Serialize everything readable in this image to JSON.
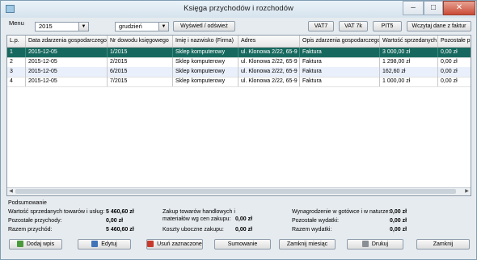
{
  "window": {
    "title": "Księga przychodów i rozchodów",
    "minimize": "–",
    "maximize": "□",
    "close": "✕"
  },
  "toolbar": {
    "menu_label": "Menu",
    "year": "2015",
    "month": "grudzień",
    "show_refresh": "Wyświetl / odśwież",
    "vat7": "VAT7",
    "vat7k": "VAT 7k",
    "pit5": "PIT5",
    "load_invoices": "Wczytaj dane z faktur"
  },
  "table": {
    "columns": [
      "L.p.",
      "Data zdarzenia gospodarczego",
      "Nr dowodu księgowego",
      "Imię i nazwisko (Firma)",
      "Adres",
      "Opis zdarzenia gospodarczego",
      "Wartość sprzedanych",
      "Pozostałe p"
    ],
    "rows": [
      [
        "1",
        "2015-12-05",
        "1/2015",
        "Sklep komputerowy",
        "ul. Klonowa 2/22, 65-9",
        "Faktura",
        "3 000,00 zł",
        "0,00 zł"
      ],
      [
        "2",
        "2015-12-05",
        "2/2015",
        "Sklep komputerowy",
        "ul. Klonowa 2/22, 65-9",
        "Faktura",
        "1 298,00 zł",
        "0,00 zł"
      ],
      [
        "3",
        "2015-12-05",
        "6/2015",
        "Sklep komputerowy",
        "ul. Klonowa 2/22, 65-9",
        "Faktura",
        "162,60 zł",
        "0,00 zł"
      ],
      [
        "4",
        "2015-12-05",
        "7/2015",
        "Sklep komputerowy",
        "ul. Klonowa 2/22, 65-9",
        "Faktura",
        "1 000,00 zł",
        "0,00 zł"
      ]
    ]
  },
  "summary": {
    "title": "Podsumowanie",
    "sales_label": "Wartość sprzedanych towarów i usług:",
    "sales_value": "5 460,60 zł",
    "other_income_label": "Pozostałe przychody:",
    "other_income_value": "0,00 zł",
    "total_income_label": "Razem przychód:",
    "total_income_value": "5 460,60 zł",
    "purchase_label_1": "Zakup towarów handlowych i",
    "purchase_label_2": "materiałów wg cen zakupu:",
    "purchase_value": "0,00 zł",
    "side_costs_label": "Koszty uboczne zakupu:",
    "side_costs_value": "0,00 zł",
    "salary_label": "Wynagrodzenie w gotówce i w naturze:",
    "salary_value": "0,00 zł",
    "other_expenses_label": "Pozostałe wydatki:",
    "other_expenses_value": "0,00 zł",
    "total_expenses_label": "Razem wydatki:",
    "total_expenses_value": "0,00 zł"
  },
  "actions": {
    "add": "Dodaj wpis",
    "edit": "Edytuj",
    "delete": "Usuń zaznaczone",
    "sum": "Sumowanie",
    "close_month": "Zamknij miesiąc",
    "print": "Drukuj",
    "close": "Zamknij"
  }
}
